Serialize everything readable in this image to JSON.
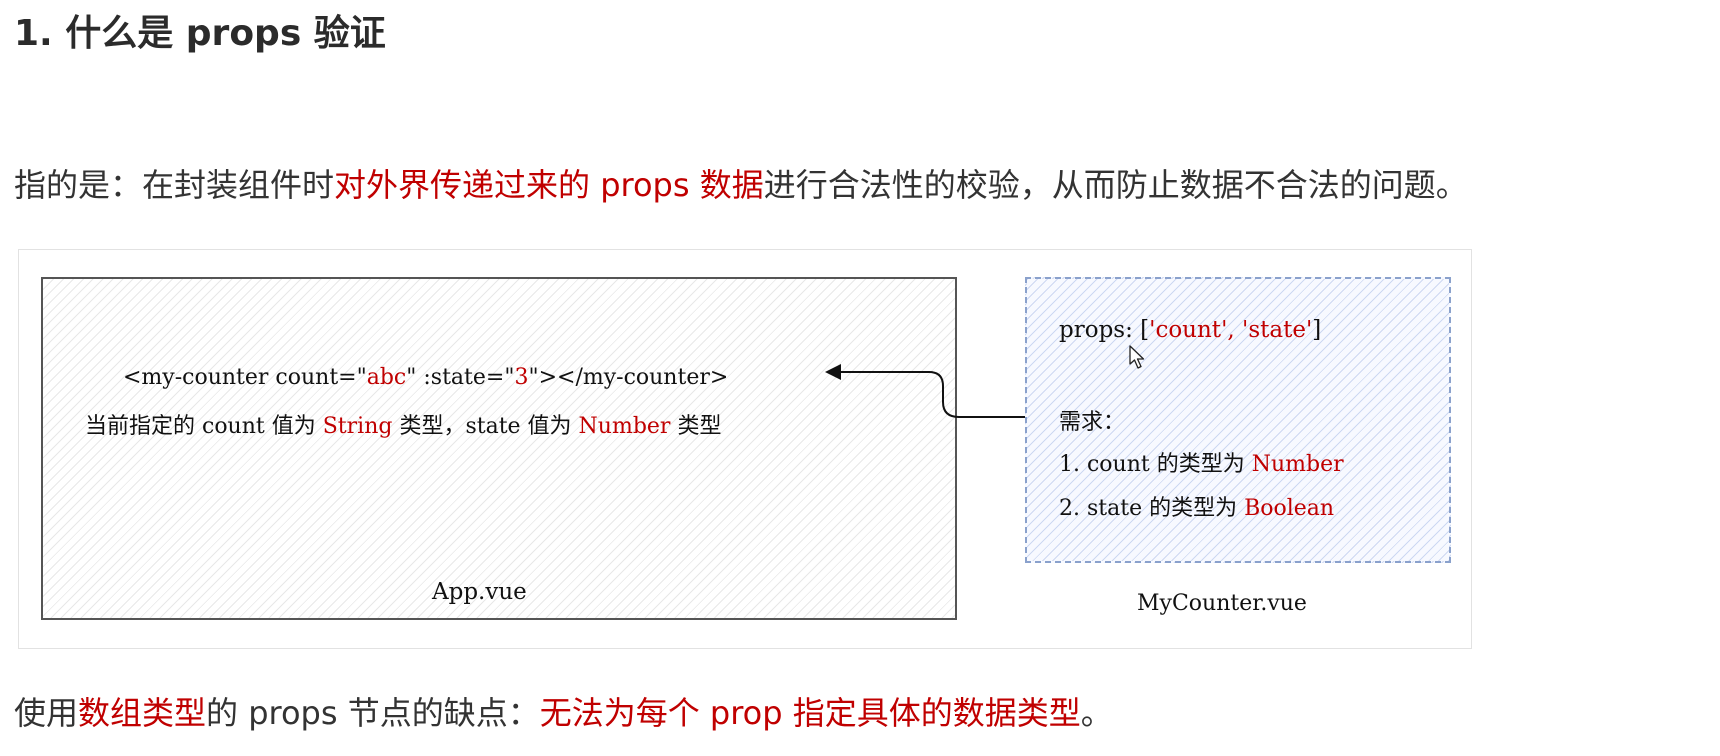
{
  "heading": "1. 什么是 props 验证",
  "intro": {
    "prefix": "指的是：在封装组件时",
    "highlight": "对外界传递过来的 props 数据",
    "suffix": "进行合法性的校验，从而防止数据不合法的问题。"
  },
  "figure": {
    "app": {
      "code": {
        "open": "<my-counter count=\"",
        "count_value": "abc",
        "mid": "\" :state=\"",
        "state_value": "3",
        "close": "\"></my-counter>"
      },
      "desc": {
        "part1": "当前指定的 count 值为 ",
        "type1": "String",
        "part2": " 类型，state 值为 ",
        "type2": "Number",
        "part3": " 类型"
      },
      "label": "App.vue"
    },
    "counter": {
      "props": {
        "prefix": "props: [",
        "q1": "'",
        "item1": "count",
        "sep": "', '",
        "item2": "state",
        "q2": "'",
        "suffix": "]"
      },
      "requirement_title": "需求：",
      "req1": {
        "text": "1. count 的类型为 ",
        "type": "Number"
      },
      "req2": {
        "text": "2. state 的类型为 ",
        "type": "Boolean"
      },
      "label": "MyCounter.vue"
    },
    "icons": [
      "arrow-left-icon",
      "mouse-cursor-icon"
    ]
  },
  "outro": {
    "p1": "使用",
    "h1": "数组类型",
    "p2": "的 props 节点的缺点：",
    "h2": "无法为每个 prop 指定具体的数据类型",
    "p3": "。"
  },
  "colors": {
    "highlight": "#c00000",
    "text": "#333333",
    "app_border": "#555555",
    "counter_border": "#8aa1cc"
  }
}
